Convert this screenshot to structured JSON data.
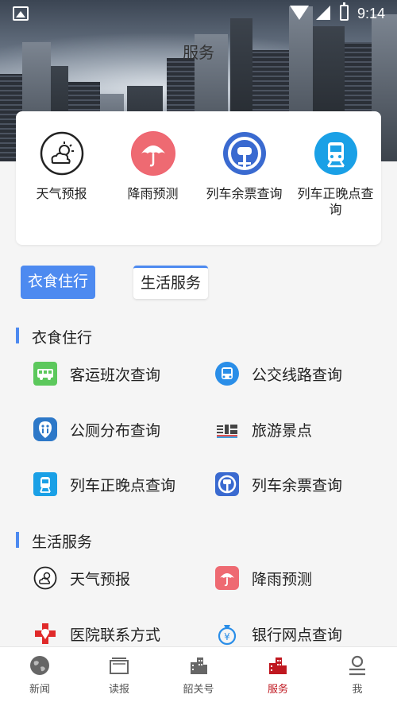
{
  "status": {
    "time": "9:14"
  },
  "header": {
    "title": "服务"
  },
  "quick": [
    {
      "label": "天气预报",
      "icon": "weather-icon"
    },
    {
      "label": "降雨预测",
      "icon": "umbrella-icon"
    },
    {
      "label": "列车余票查询",
      "icon": "railway-logo-icon"
    },
    {
      "label": "列车正晚点查询",
      "icon": "train-icon"
    }
  ],
  "tabs": [
    {
      "label": "衣食住行",
      "active": true
    },
    {
      "label": "生活服务",
      "active": false
    }
  ],
  "sections": [
    {
      "title": "衣食住行",
      "items": [
        {
          "label": "客运班次查询",
          "icon": "bus-icon"
        },
        {
          "label": "公交线路查询",
          "icon": "city-bus-icon"
        },
        {
          "label": "公厕分布查询",
          "icon": "toilet-icon"
        },
        {
          "label": "旅游景点",
          "icon": "scenic-spot-icon"
        },
        {
          "label": "列车正晚点查询",
          "icon": "train-icon"
        },
        {
          "label": "列车余票查询",
          "icon": "railway-logo-icon"
        }
      ]
    },
    {
      "title": "生活服务",
      "items": [
        {
          "label": "天气预报",
          "icon": "weather-icon"
        },
        {
          "label": "降雨预测",
          "icon": "umbrella-icon"
        },
        {
          "label": "医院联系方式",
          "icon": "hospital-cross-icon"
        },
        {
          "label": "银行网点查询",
          "icon": "money-bag-icon"
        }
      ]
    }
  ],
  "nav": [
    {
      "label": "新闻",
      "icon": "globe-icon"
    },
    {
      "label": "读报",
      "icon": "newspaper-icon"
    },
    {
      "label": "韶关号",
      "icon": "building-icon"
    },
    {
      "label": "服务",
      "icon": "service-icon",
      "active": true
    },
    {
      "label": "我",
      "icon": "user-icon"
    }
  ],
  "colors": {
    "accent": "#4d8af0",
    "active_nav": "#c01820"
  }
}
